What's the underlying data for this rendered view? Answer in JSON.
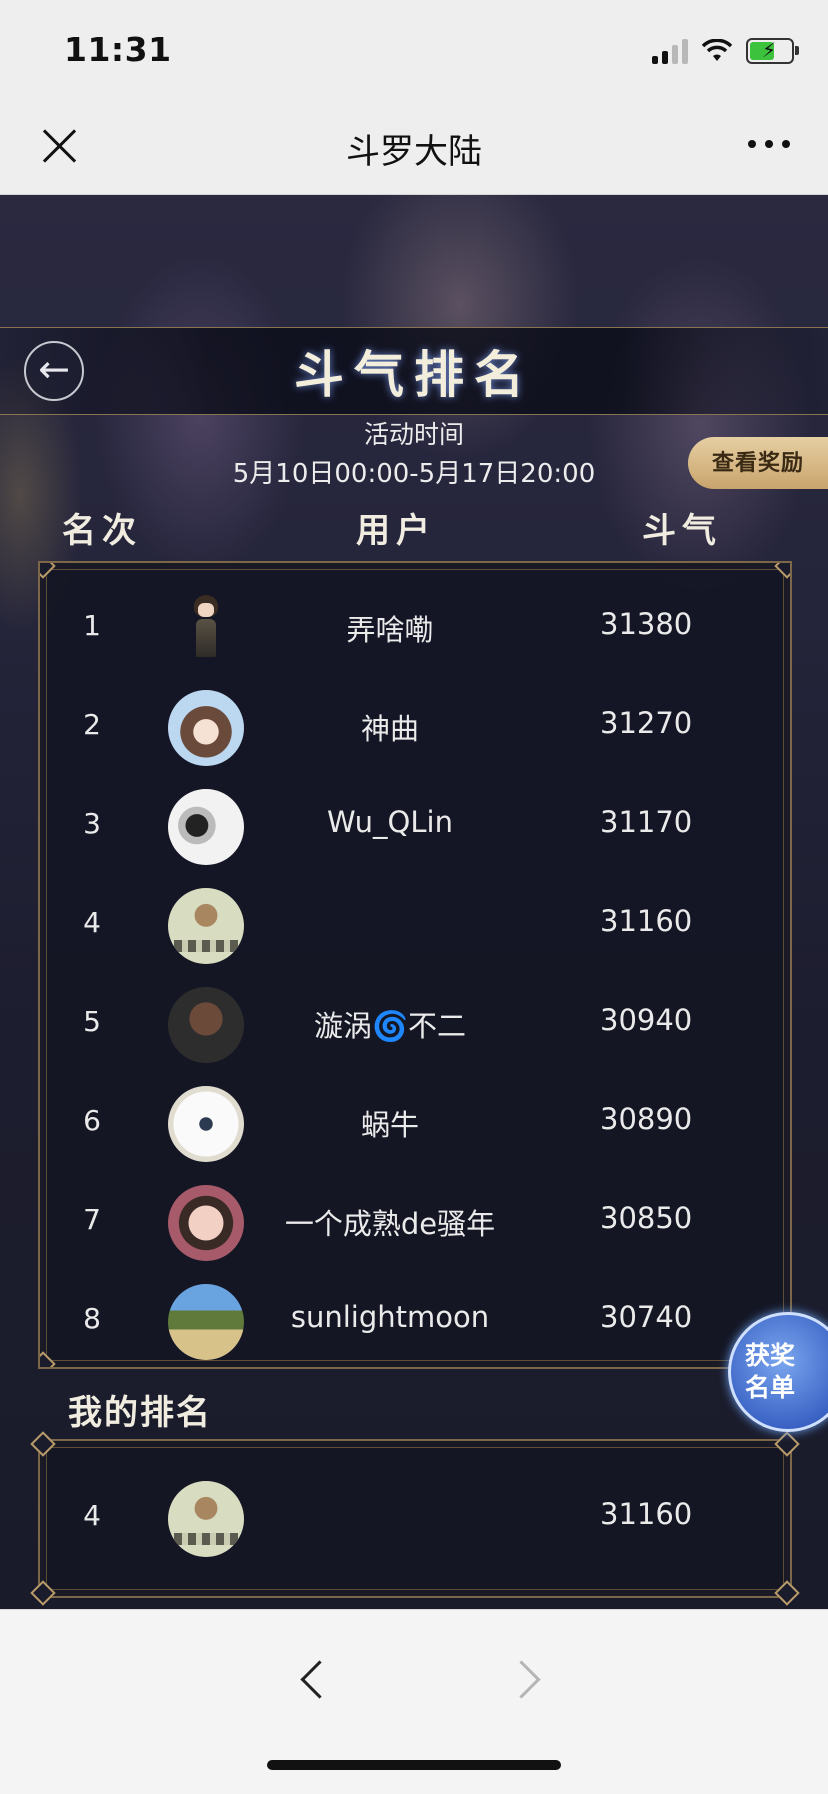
{
  "status": {
    "time": "11:31"
  },
  "nav": {
    "title": "斗罗大陆"
  },
  "game": {
    "page_title": "斗气排名",
    "activity_label": "活动时间",
    "activity_range": "5月10日00:00-5月17日20:00",
    "reward_button": "查看奖励",
    "columns": {
      "rank": "名次",
      "user": "用户",
      "score": "斗气"
    },
    "rows": [
      {
        "rank": "1",
        "name": "弄啥嘞",
        "score": "31380"
      },
      {
        "rank": "2",
        "name": "神曲",
        "score": "31270"
      },
      {
        "rank": "3",
        "name": "Wu_QLin",
        "score": "31170"
      },
      {
        "rank": "4",
        "name": "",
        "score": "31160"
      },
      {
        "rank": "5",
        "name": "漩涡🌀不二",
        "score": "30940"
      },
      {
        "rank": "6",
        "name": "蜗牛",
        "score": "30890"
      },
      {
        "rank": "7",
        "name": "一个成熟de骚年",
        "score": "30850"
      },
      {
        "rank": "8",
        "name": "sunlightmoon",
        "score": "30740"
      }
    ],
    "my_rank_label": "我的排名",
    "my_row": {
      "rank": "4",
      "name": "",
      "score": "31160"
    },
    "winners_button": {
      "line1": "获奖",
      "line2": "名单"
    }
  },
  "colors": {
    "accent_gold": "#c9a46c",
    "panel_bg": "#14162a",
    "winners_blue": "#3c64c6"
  }
}
